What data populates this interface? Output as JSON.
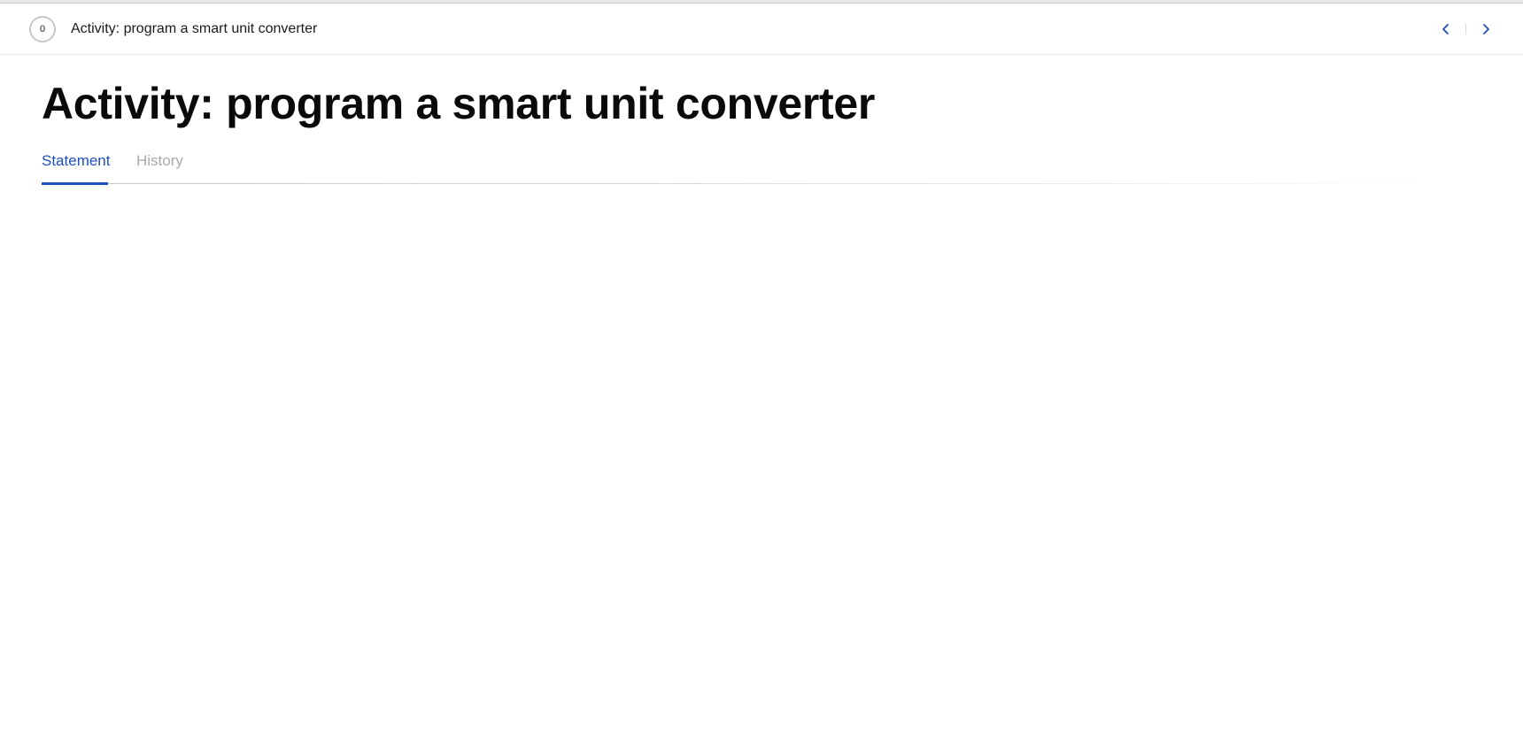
{
  "header": {
    "score": "0",
    "title": "Activity: program a smart unit converter",
    "prev_icon": "chevron-left-icon",
    "next_icon": "chevron-right-icon"
  },
  "main": {
    "title": "Activity: program a smart unit converter",
    "tabs": [
      {
        "label": "Statement",
        "active": true
      },
      {
        "label": "History",
        "active": false
      }
    ]
  },
  "colors": {
    "accent": "#1f4fbf",
    "muted_tab": "#a9a9a9"
  }
}
